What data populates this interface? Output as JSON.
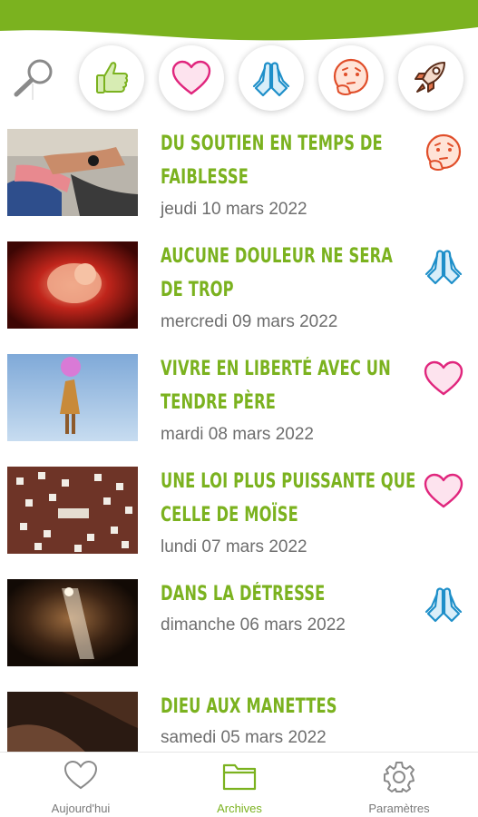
{
  "header": {
    "brand_color": "#7bb21f"
  },
  "filters": [
    {
      "icon": "thumbs-up-icon"
    },
    {
      "icon": "heart-icon"
    },
    {
      "icon": "praying-hands-icon"
    },
    {
      "icon": "thinking-face-icon"
    },
    {
      "icon": "rocket-icon"
    }
  ],
  "articles": [
    {
      "title": "DU SOUTIEN EN TEMPS DE FAIBLESSE",
      "date": "jeudi 10 mars 2022",
      "category_icon": "thinking-face-icon"
    },
    {
      "title": "AUCUNE DOULEUR NE SERA DE TROP",
      "date": "mercredi 09 mars 2022",
      "category_icon": "praying-hands-icon"
    },
    {
      "title": "VIVRE EN LIBERTÉ AVEC UN TENDRE PÈRE",
      "date": "mardi 08 mars 2022",
      "category_icon": "heart-icon"
    },
    {
      "title": "UNE LOI PLUS PUISSANTE QUE CELLE DE MOÏSE",
      "date": "lundi 07 mars 2022",
      "category_icon": "heart-icon"
    },
    {
      "title": "DANS LA DÉTRESSE",
      "date": "dimanche 06 mars 2022",
      "category_icon": "praying-hands-icon"
    },
    {
      "title": "DIEU AUX MANETTES",
      "date": "samedi 05 mars 2022",
      "category_icon": ""
    }
  ],
  "nav": {
    "today_label": "Aujourd'hui",
    "archives_label": "Archives",
    "settings_label": "Paramètres",
    "active": "archives"
  }
}
